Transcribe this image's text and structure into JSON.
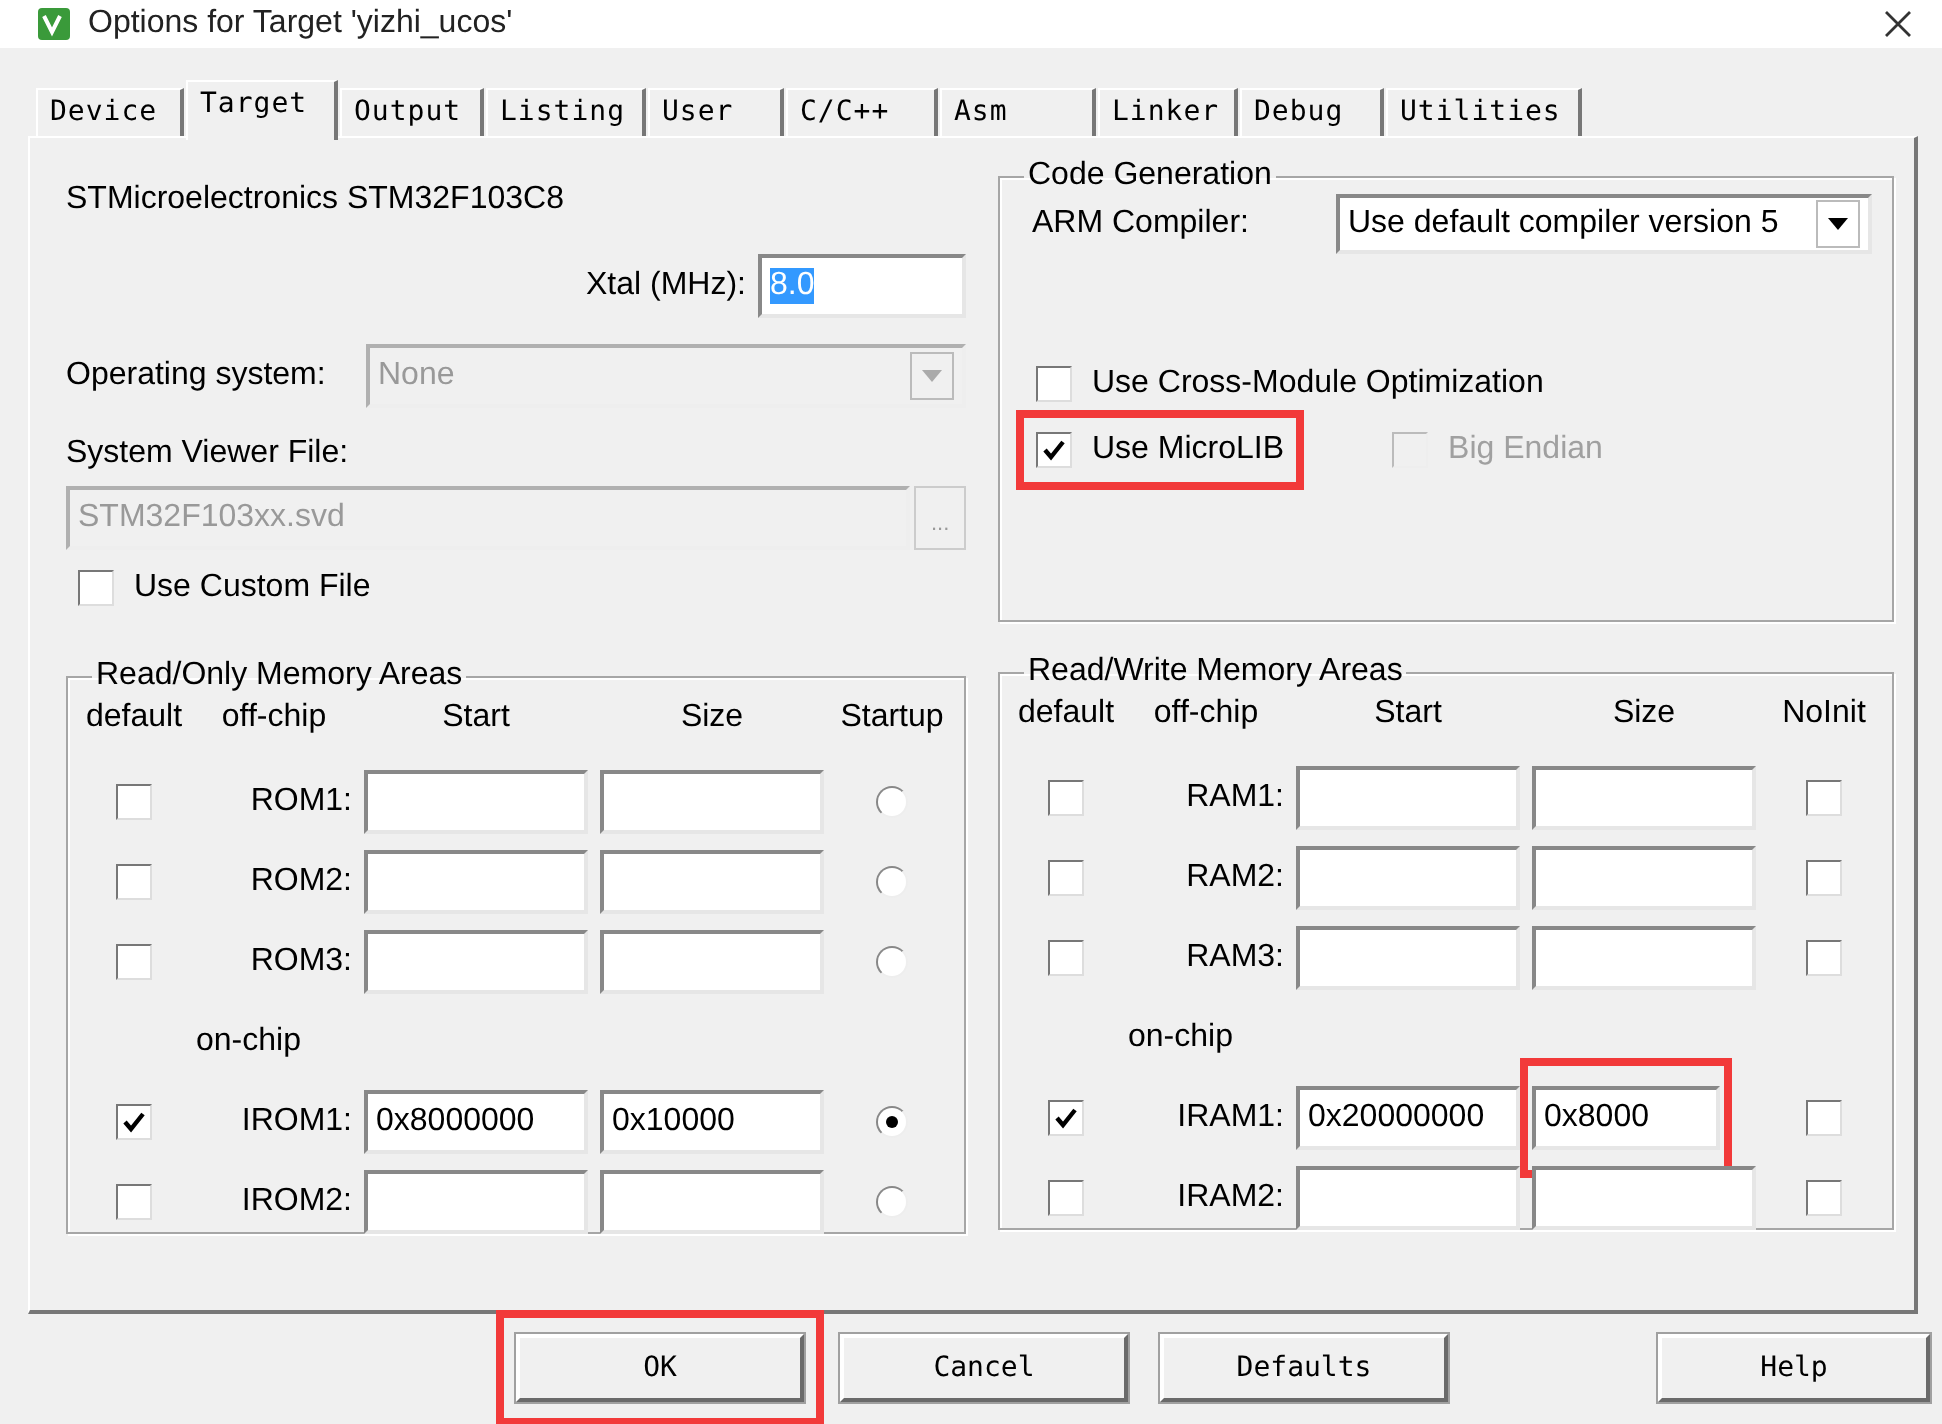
{
  "window": {
    "title": "Options for Target 'yizhi_ucos'"
  },
  "tabs": [
    {
      "label": "Device",
      "selected": false
    },
    {
      "label": "Target",
      "selected": true
    },
    {
      "label": "Output",
      "selected": false
    },
    {
      "label": "Listing",
      "selected": false
    },
    {
      "label": "User",
      "selected": false
    },
    {
      "label": "C/C++",
      "selected": false
    },
    {
      "label": "Asm",
      "selected": false
    },
    {
      "label": "Linker",
      "selected": false
    },
    {
      "label": "Debug",
      "selected": false
    },
    {
      "label": "Utilities",
      "selected": false
    }
  ],
  "device": {
    "name": "STMicroelectronics STM32F103C8"
  },
  "xtal": {
    "label": "Xtal (MHz):",
    "value": "8.0",
    "text_selected": true
  },
  "operating_system": {
    "label": "Operating system:",
    "value": "None",
    "disabled": true
  },
  "system_viewer": {
    "label": "System Viewer File:",
    "value": "STM32F103xx.svd",
    "disabled": true,
    "browse": "..."
  },
  "use_custom_file": {
    "label": "Use Custom File",
    "checked": false
  },
  "code_generation": {
    "title": "Code Generation",
    "compiler_label": "ARM Compiler:",
    "compiler_value": "Use default compiler version 5",
    "option_rows": [
      {
        "options": [
          {
            "label": "Use Cross-Module Optimization",
            "checked": false,
            "disabled": false,
            "highlighted": false
          }
        ]
      },
      {
        "options": [
          {
            "label": "Use MicroLIB",
            "checked": true,
            "disabled": false,
            "highlighted": true
          },
          {
            "label": "Big Endian",
            "checked": false,
            "disabled": true,
            "highlighted": false
          }
        ]
      }
    ]
  },
  "rom": {
    "title": "Read/Only Memory Areas",
    "columns": [
      "default",
      "off-chip",
      "Start",
      "Size",
      "Startup"
    ],
    "rows": [
      {
        "kind": "area",
        "default": false,
        "label": "ROM1:",
        "selected": false,
        "size_highlighted": false
      },
      {
        "kind": "area",
        "default": false,
        "label": "ROM2:",
        "selected": false,
        "size_highlighted": false
      },
      {
        "kind": "area",
        "default": false,
        "label": "ROM3:",
        "selected": false,
        "size_highlighted": false
      },
      {
        "kind": "heading",
        "label": "on-chip"
      },
      {
        "kind": "area",
        "default": true,
        "label": "IROM1:",
        "start": "0x8000000",
        "size": "0x10000",
        "selected": true,
        "size_highlighted": false
      },
      {
        "kind": "area",
        "default": false,
        "label": "IROM2:",
        "selected": false,
        "size_highlighted": false
      }
    ]
  },
  "ram": {
    "title": "Read/Write Memory Areas",
    "columns": [
      "default",
      "off-chip",
      "Start",
      "Size",
      "NoInit"
    ],
    "rows": [
      {
        "kind": "area",
        "default": false,
        "label": "RAM1:",
        "no_init": false,
        "size_highlighted": false
      },
      {
        "kind": "area",
        "default": false,
        "label": "RAM2:",
        "no_init": false,
        "size_highlighted": false
      },
      {
        "kind": "area",
        "default": false,
        "label": "RAM3:",
        "no_init": false,
        "size_highlighted": false
      },
      {
        "kind": "heading",
        "label": "on-chip"
      },
      {
        "kind": "area",
        "default": true,
        "label": "IRAM1:",
        "start": "0x20000000",
        "size": "0x8000",
        "no_init": false,
        "size_highlighted": true
      },
      {
        "kind": "area",
        "default": false,
        "label": "IRAM2:",
        "no_init": false,
        "size_highlighted": false
      }
    ]
  },
  "buttons": [
    {
      "label": "OK",
      "highlighted": true
    },
    {
      "label": "Cancel",
      "highlighted": false
    },
    {
      "label": "Defaults",
      "highlighted": false
    },
    {
      "label": "Help",
      "highlighted": false
    }
  ]
}
